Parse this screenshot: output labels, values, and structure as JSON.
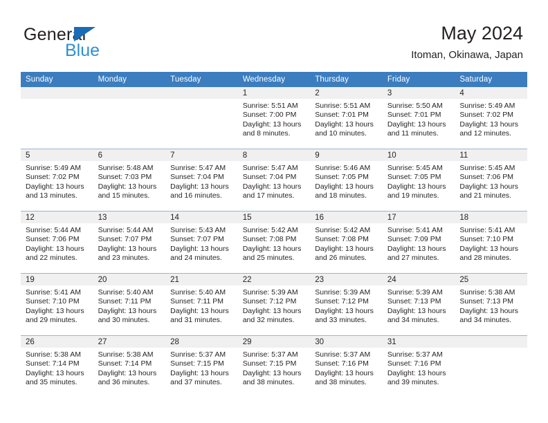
{
  "brand": {
    "name_top": "General",
    "name_bottom": "Blue",
    "triangle_color": "#1b6cb5",
    "blue_color": "#2f8ed6"
  },
  "header": {
    "title": "May 2024",
    "subtitle": "Itoman, Okinawa, Japan"
  },
  "colors": {
    "header_row": "#3b7dbf",
    "daynum_bar": "#f0f0f0",
    "grid_line": "#9ab4cd",
    "text": "#231f20"
  },
  "weekday_headers": [
    "Sunday",
    "Monday",
    "Tuesday",
    "Wednesday",
    "Thursday",
    "Friday",
    "Saturday"
  ],
  "weeks": [
    [
      {
        "day": "",
        "empty": true
      },
      {
        "day": "",
        "empty": true
      },
      {
        "day": "",
        "empty": true
      },
      {
        "day": "1",
        "sunrise": "Sunrise: 5:51 AM",
        "sunset": "Sunset: 7:00 PM",
        "daylight": "Daylight: 13 hours and 8 minutes."
      },
      {
        "day": "2",
        "sunrise": "Sunrise: 5:51 AM",
        "sunset": "Sunset: 7:01 PM",
        "daylight": "Daylight: 13 hours and 10 minutes."
      },
      {
        "day": "3",
        "sunrise": "Sunrise: 5:50 AM",
        "sunset": "Sunset: 7:01 PM",
        "daylight": "Daylight: 13 hours and 11 minutes."
      },
      {
        "day": "4",
        "sunrise": "Sunrise: 5:49 AM",
        "sunset": "Sunset: 7:02 PM",
        "daylight": "Daylight: 13 hours and 12 minutes."
      }
    ],
    [
      {
        "day": "5",
        "sunrise": "Sunrise: 5:49 AM",
        "sunset": "Sunset: 7:02 PM",
        "daylight": "Daylight: 13 hours and 13 minutes."
      },
      {
        "day": "6",
        "sunrise": "Sunrise: 5:48 AM",
        "sunset": "Sunset: 7:03 PM",
        "daylight": "Daylight: 13 hours and 15 minutes."
      },
      {
        "day": "7",
        "sunrise": "Sunrise: 5:47 AM",
        "sunset": "Sunset: 7:04 PM",
        "daylight": "Daylight: 13 hours and 16 minutes."
      },
      {
        "day": "8",
        "sunrise": "Sunrise: 5:47 AM",
        "sunset": "Sunset: 7:04 PM",
        "daylight": "Daylight: 13 hours and 17 minutes."
      },
      {
        "day": "9",
        "sunrise": "Sunrise: 5:46 AM",
        "sunset": "Sunset: 7:05 PM",
        "daylight": "Daylight: 13 hours and 18 minutes."
      },
      {
        "day": "10",
        "sunrise": "Sunrise: 5:45 AM",
        "sunset": "Sunset: 7:05 PM",
        "daylight": "Daylight: 13 hours and 19 minutes."
      },
      {
        "day": "11",
        "sunrise": "Sunrise: 5:45 AM",
        "sunset": "Sunset: 7:06 PM",
        "daylight": "Daylight: 13 hours and 21 minutes."
      }
    ],
    [
      {
        "day": "12",
        "sunrise": "Sunrise: 5:44 AM",
        "sunset": "Sunset: 7:06 PM",
        "daylight": "Daylight: 13 hours and 22 minutes."
      },
      {
        "day": "13",
        "sunrise": "Sunrise: 5:44 AM",
        "sunset": "Sunset: 7:07 PM",
        "daylight": "Daylight: 13 hours and 23 minutes."
      },
      {
        "day": "14",
        "sunrise": "Sunrise: 5:43 AM",
        "sunset": "Sunset: 7:07 PM",
        "daylight": "Daylight: 13 hours and 24 minutes."
      },
      {
        "day": "15",
        "sunrise": "Sunrise: 5:42 AM",
        "sunset": "Sunset: 7:08 PM",
        "daylight": "Daylight: 13 hours and 25 minutes."
      },
      {
        "day": "16",
        "sunrise": "Sunrise: 5:42 AM",
        "sunset": "Sunset: 7:08 PM",
        "daylight": "Daylight: 13 hours and 26 minutes."
      },
      {
        "day": "17",
        "sunrise": "Sunrise: 5:41 AM",
        "sunset": "Sunset: 7:09 PM",
        "daylight": "Daylight: 13 hours and 27 minutes."
      },
      {
        "day": "18",
        "sunrise": "Sunrise: 5:41 AM",
        "sunset": "Sunset: 7:10 PM",
        "daylight": "Daylight: 13 hours and 28 minutes."
      }
    ],
    [
      {
        "day": "19",
        "sunrise": "Sunrise: 5:41 AM",
        "sunset": "Sunset: 7:10 PM",
        "daylight": "Daylight: 13 hours and 29 minutes."
      },
      {
        "day": "20",
        "sunrise": "Sunrise: 5:40 AM",
        "sunset": "Sunset: 7:11 PM",
        "daylight": "Daylight: 13 hours and 30 minutes."
      },
      {
        "day": "21",
        "sunrise": "Sunrise: 5:40 AM",
        "sunset": "Sunset: 7:11 PM",
        "daylight": "Daylight: 13 hours and 31 minutes."
      },
      {
        "day": "22",
        "sunrise": "Sunrise: 5:39 AM",
        "sunset": "Sunset: 7:12 PM",
        "daylight": "Daylight: 13 hours and 32 minutes."
      },
      {
        "day": "23",
        "sunrise": "Sunrise: 5:39 AM",
        "sunset": "Sunset: 7:12 PM",
        "daylight": "Daylight: 13 hours and 33 minutes."
      },
      {
        "day": "24",
        "sunrise": "Sunrise: 5:39 AM",
        "sunset": "Sunset: 7:13 PM",
        "daylight": "Daylight: 13 hours and 34 minutes."
      },
      {
        "day": "25",
        "sunrise": "Sunrise: 5:38 AM",
        "sunset": "Sunset: 7:13 PM",
        "daylight": "Daylight: 13 hours and 34 minutes."
      }
    ],
    [
      {
        "day": "26",
        "sunrise": "Sunrise: 5:38 AM",
        "sunset": "Sunset: 7:14 PM",
        "daylight": "Daylight: 13 hours and 35 minutes."
      },
      {
        "day": "27",
        "sunrise": "Sunrise: 5:38 AM",
        "sunset": "Sunset: 7:14 PM",
        "daylight": "Daylight: 13 hours and 36 minutes."
      },
      {
        "day": "28",
        "sunrise": "Sunrise: 5:37 AM",
        "sunset": "Sunset: 7:15 PM",
        "daylight": "Daylight: 13 hours and 37 minutes."
      },
      {
        "day": "29",
        "sunrise": "Sunrise: 5:37 AM",
        "sunset": "Sunset: 7:15 PM",
        "daylight": "Daylight: 13 hours and 38 minutes."
      },
      {
        "day": "30",
        "sunrise": "Sunrise: 5:37 AM",
        "sunset": "Sunset: 7:16 PM",
        "daylight": "Daylight: 13 hours and 38 minutes."
      },
      {
        "day": "31",
        "sunrise": "Sunrise: 5:37 AM",
        "sunset": "Sunset: 7:16 PM",
        "daylight": "Daylight: 13 hours and 39 minutes."
      },
      {
        "day": "",
        "empty": true
      }
    ]
  ]
}
